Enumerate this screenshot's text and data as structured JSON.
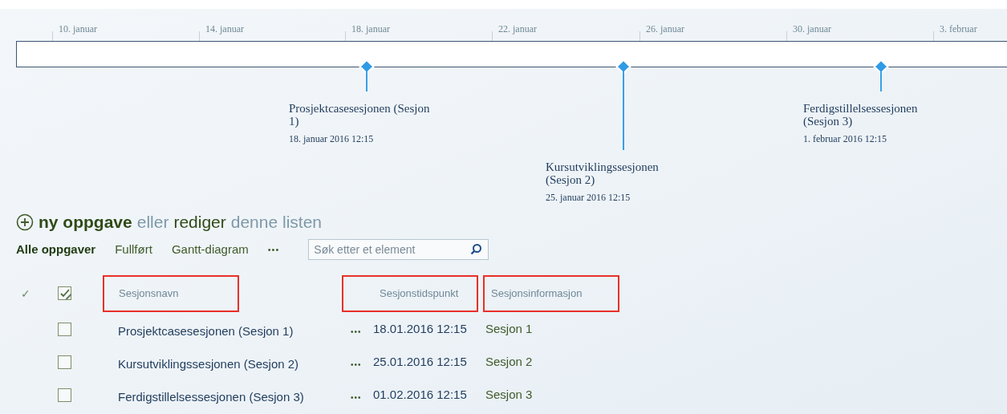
{
  "timeline": {
    "ticks": [
      "10. januar",
      "14. januar",
      "18. januar",
      "22. januar",
      "26. januar",
      "30. januar",
      "3. februar"
    ],
    "milestones": [
      {
        "title": "Prosjektcasesesjonen (Sesjon 1)",
        "date": "18. januar 2016 12:15"
      },
      {
        "title": "Kursutviklingssesjonen (Sesjon 2)",
        "date": "25. januar 2016 12:15"
      },
      {
        "title": "Ferdigstillelsessesjonen (Sesjon 3)",
        "date": "1. februar 2016 12:15"
      }
    ]
  },
  "heading": {
    "new_item": "ny oppgave",
    "or": "eller",
    "edit": "rediger",
    "list": "denne listen"
  },
  "views": [
    {
      "label": "Alle oppgaver",
      "selected": true
    },
    {
      "label": "Fullført",
      "selected": false
    },
    {
      "label": "Gantt-diagram",
      "selected": false
    }
  ],
  "more_views": "•••",
  "search": {
    "placeholder": "Søk etter et element"
  },
  "table": {
    "header_check": "✓",
    "select_all_checked": true,
    "columns": [
      {
        "label": "Sesjonsnavn",
        "highlighted": true
      },
      {
        "label": "Sesjonstidspunkt",
        "highlighted": true
      },
      {
        "label": "Sesjonsinformasjon",
        "highlighted": true
      }
    ],
    "rows": [
      {
        "checked": false,
        "name": "Prosjektcasesesjonen (Sesjon 1)",
        "menu": "•••",
        "time": "18.01.2016 12:15",
        "info": "Sesjon 1"
      },
      {
        "checked": false,
        "name": "Kursutviklingssesjonen (Sesjon 2)",
        "menu": "•••",
        "time": "25.01.2016 12:15",
        "info": "Sesjon 2"
      },
      {
        "checked": false,
        "name": "Ferdigstillelsessesjonen (Sesjon 3)",
        "menu": "•••",
        "time": "01.02.2016 12:15",
        "info": "Sesjon 3"
      }
    ]
  }
}
